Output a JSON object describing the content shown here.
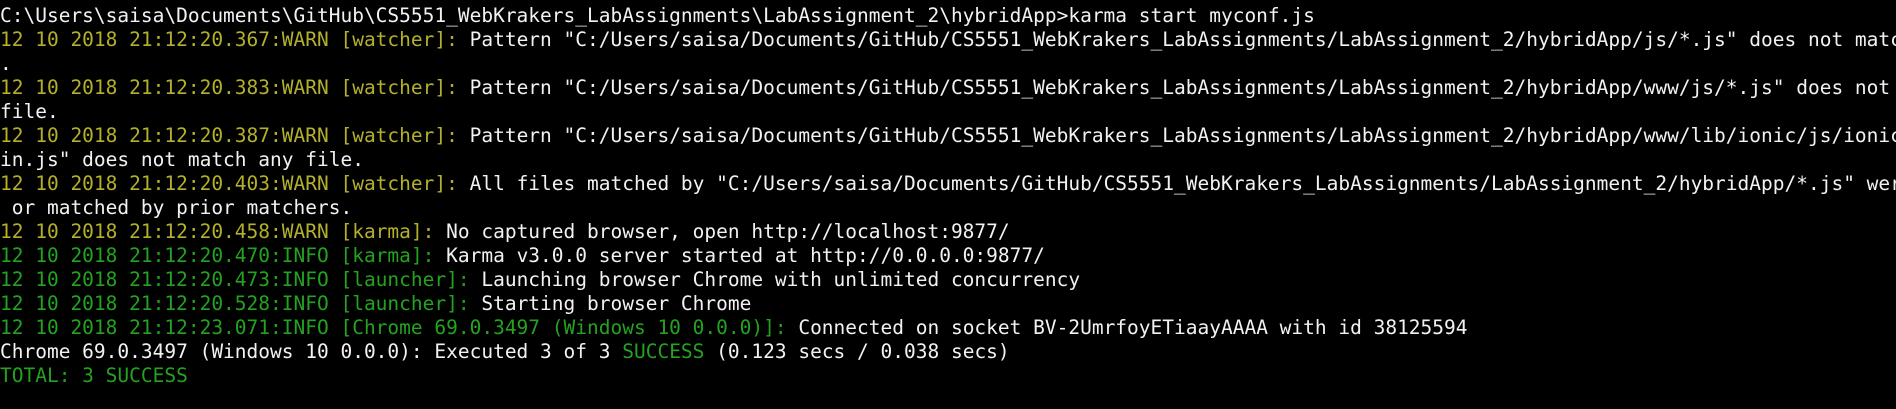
{
  "terminal": {
    "prompt_line": "C:\\Users\\saisa\\Documents\\GitHub\\CS5551_WebKrakers_LabAssignments\\LabAssignment_2\\hybridApp>karma start myconf.js",
    "log": [
      {
        "stamp": "12 10 2018 21:12:20.367:WARN [watcher]: ",
        "message": "Pattern \"C:/Users/saisa/Documents/GitHub/CS5551_WebKrakers_LabAssignments/LabAssignment_2/hybridApp/js/*.js\" does not match any file",
        "continuation": "."
      },
      {
        "stamp": "12 10 2018 21:12:20.383:WARN [watcher]: ",
        "message": "Pattern \"C:/Users/saisa/Documents/GitHub/CS5551_WebKrakers_LabAssignments/LabAssignment_2/hybridApp/www/js/*.js\" does not match any",
        "continuation": "file."
      },
      {
        "stamp": "12 10 2018 21:12:20.387:WARN [watcher]: ",
        "message": "Pattern \"C:/Users/saisa/Documents/GitHub/CS5551_WebKrakers_LabAssignments/LabAssignment_2/hybridApp/www/lib/ionic/js/ionic-angular.m",
        "continuation": "in.js\" does not match any file."
      },
      {
        "stamp": "12 10 2018 21:12:20.403:WARN [watcher]: ",
        "message": "All files matched by \"C:/Users/saisa/Documents/GitHub/CS5551_WebKrakers_LabAssignments/LabAssignment_2/hybridApp/*.js\" were excluded",
        "continuation": " or matched by prior matchers."
      },
      {
        "stamp": "12 10 2018 21:12:20.458:WARN [karma]: ",
        "message": "No captured browser, open http://localhost:9877/"
      },
      {
        "stamp": "12 10 2018 21:12:20.470:INFO [karma]: ",
        "message": "Karma v3.0.0 server started at http://0.0.0.0:9877/"
      },
      {
        "stamp": "12 10 2018 21:12:20.473:INFO [launcher]: ",
        "message": "Launching browser Chrome with unlimited concurrency"
      },
      {
        "stamp": "12 10 2018 21:12:20.528:INFO [launcher]: ",
        "message": "Starting browser Chrome"
      },
      {
        "stamp": "12 10 2018 21:12:23.071:INFO [Chrome 69.0.3497 (Windows 10 0.0.0)]: ",
        "message": "Connected on socket BV-2UmrfoyETiaayAAAA with id 38125594"
      }
    ],
    "result": {
      "prefix": "Chrome 69.0.3497 (Windows 10 0.0.0): Executed 3 of 3 ",
      "status": "SUCCESS",
      "suffix": " (0.123 secs / 0.038 secs)"
    },
    "total": "TOTAL: 3 SUCCESS"
  },
  "colors": {
    "background": "#000000",
    "text": "#f2f2f2",
    "warn": "#b5b02b",
    "info_success": "#23a31f"
  }
}
